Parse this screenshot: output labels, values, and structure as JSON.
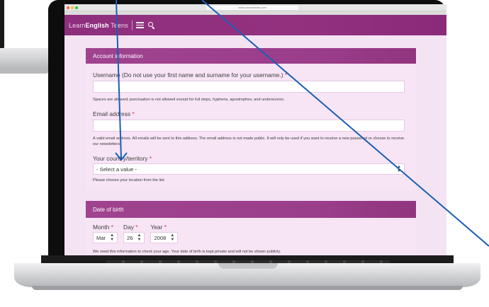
{
  "browser": {
    "url": "www.yourwebsite.com"
  },
  "header": {
    "logo_prefix": "Learn",
    "logo_bold": "English",
    "logo_suffix": " Teens"
  },
  "account": {
    "section_title": "Account information",
    "username_label": "Username (Do not use your first name and surname for your username.)",
    "required_mark": "*",
    "username_help": "Spaces are allowed; punctuation is not allowed except for full stops, hyphens, apostrophes, and underscores.",
    "email_label": "Email address",
    "email_help": "A valid email address. All emails will be sent to this address. The email address is not made public. It will only be used if you want to receive a new password or choose to receive our newsletters.",
    "country_label": "Your country/territory",
    "country_value": "- Select a value -",
    "country_help": "Please choose your location from the list."
  },
  "dob": {
    "section_title": "Date of birth",
    "month_label": "Month",
    "day_label": "Day",
    "year_label": "Year",
    "month_value": "Mar",
    "day_value": "26",
    "year_value": "2008",
    "help": "We need this information to check your age. Your date of birth is kept private and will not be shown publicly."
  },
  "colors": {
    "brand_purple": "#8e2f7d",
    "panel_pink": "#f7e4f5",
    "required_red": "#d43a3a",
    "annotation_blue": "#1a5fb4"
  },
  "icons": [
    "menu-icon",
    "search-icon",
    "select-arrows-icon",
    "annotation-arrow-icon"
  ]
}
